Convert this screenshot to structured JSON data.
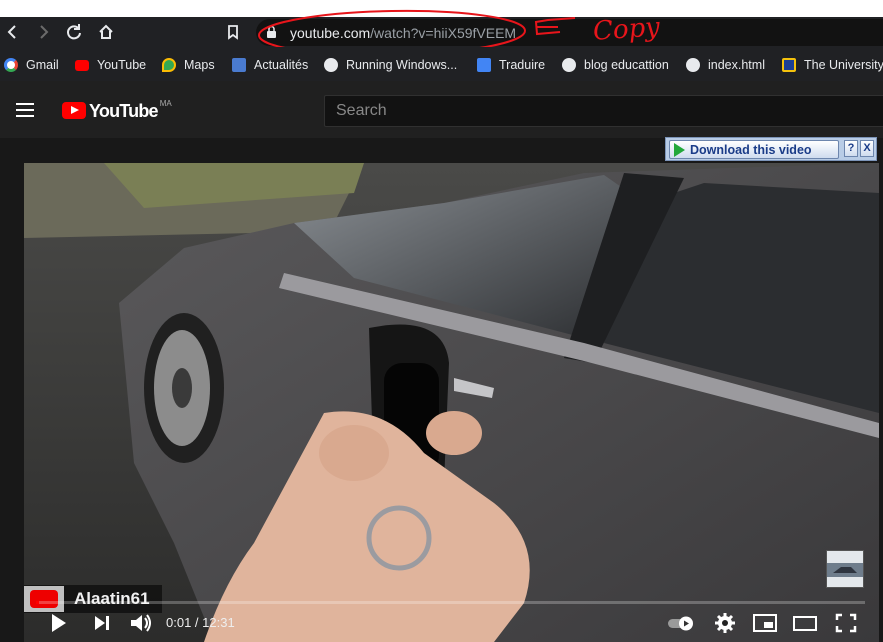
{
  "browser": {
    "nav": {
      "back_icon": "back-arrow-icon",
      "forward_icon": "forward-arrow-icon",
      "reload_icon": "reload-icon",
      "home_icon": "home-icon",
      "bookmark_icon": "bookmark-icon"
    },
    "url_host": "youtube.com",
    "url_path": "/watch?v=hiiX59fVEEM",
    "annotation_text": "Copy",
    "annotation_color": "#e8151b"
  },
  "bookmarks": [
    {
      "label": "Gmail",
      "icon": "google-icon",
      "color": "#4285f4"
    },
    {
      "label": "YouTube",
      "icon": "youtube-icon",
      "color": "#ff0000"
    },
    {
      "label": "Maps",
      "icon": "maps-icon",
      "color": "#34a853"
    },
    {
      "label": "Actualités",
      "icon": "news-icon",
      "color": "#4a7bd0"
    },
    {
      "label": "Running Windows...",
      "icon": "globe-icon",
      "color": "#e8eaed"
    },
    {
      "label": "Traduire",
      "icon": "translate-icon",
      "color": "#4285f4"
    },
    {
      "label": "blog educattion",
      "icon": "globe-icon",
      "color": "#e8eaed"
    },
    {
      "label": "index.html",
      "icon": "globe-icon",
      "color": "#e8eaed"
    },
    {
      "label": "The University",
      "icon": "university-icon",
      "color": "#f4c20d"
    }
  ],
  "youtube": {
    "logo_text": "YouTube",
    "country_code": "MA",
    "search_placeholder": "Search"
  },
  "downloader": {
    "button_label": "Download this video",
    "help_label": "?",
    "close_label": "X"
  },
  "player": {
    "channel_name": "Alaatin61",
    "current_time": "0:01",
    "duration": "12:31",
    "time_display": "0:01 / 12:31",
    "progress": 0.0013
  }
}
